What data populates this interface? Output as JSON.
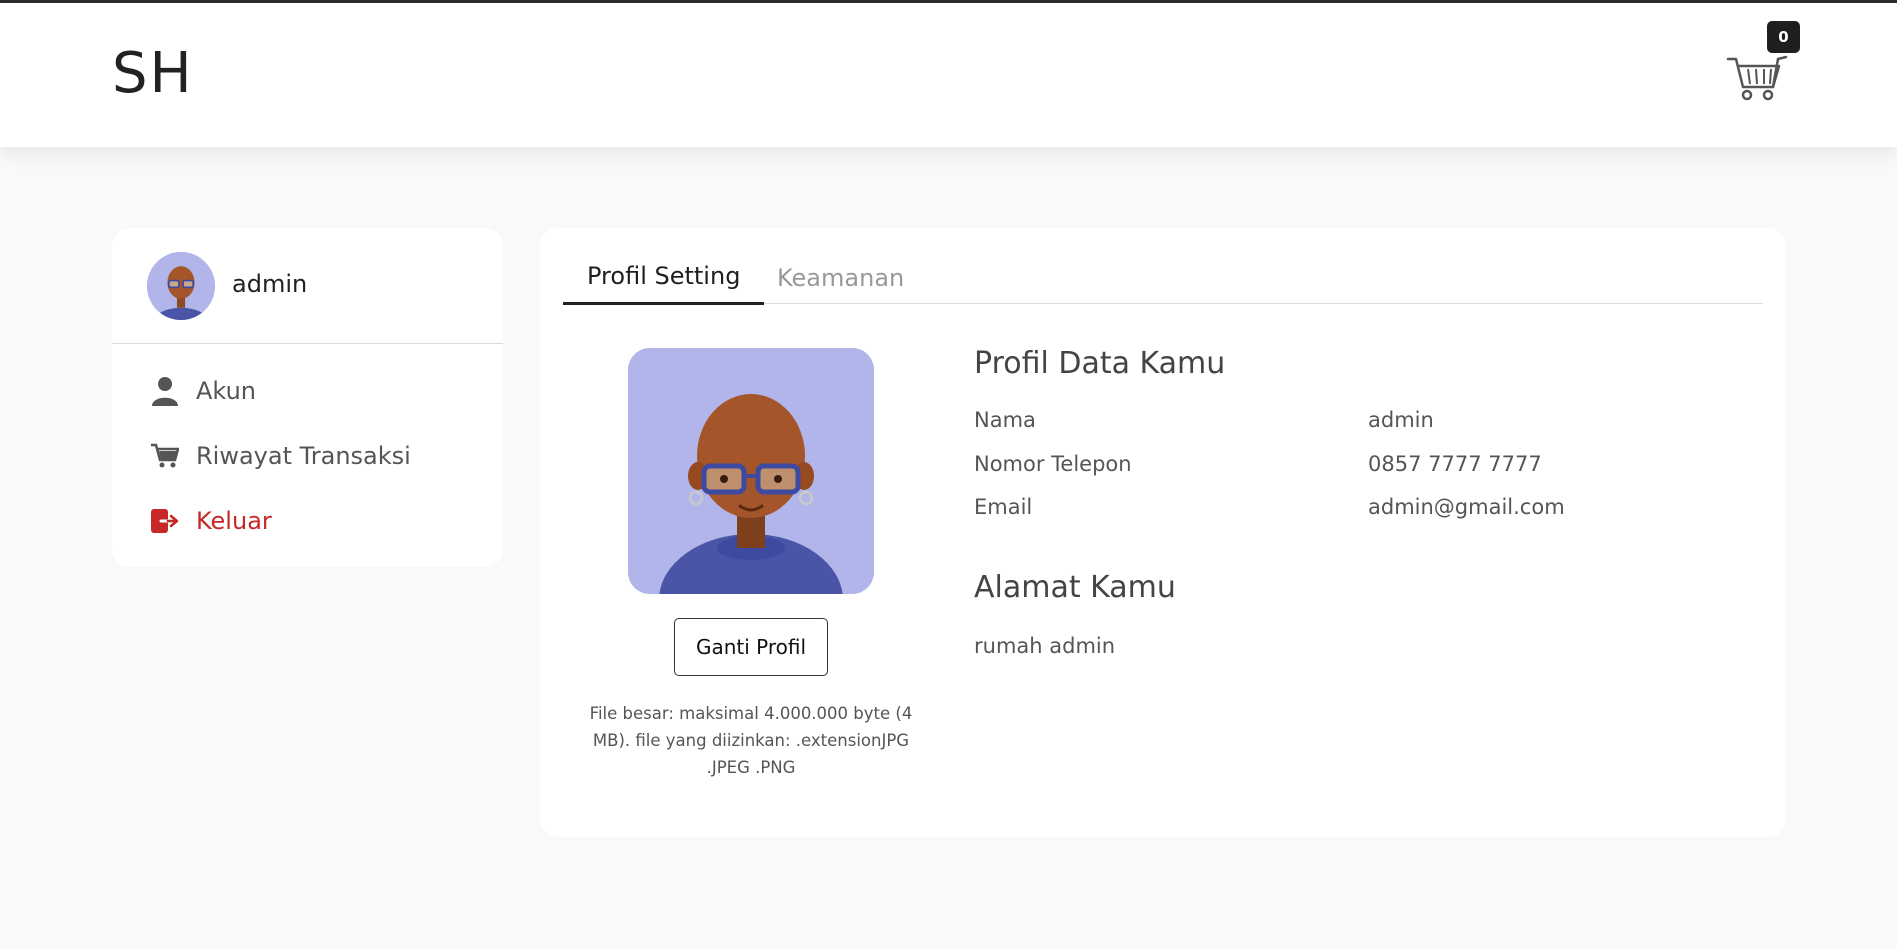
{
  "header": {
    "brand": "SH",
    "cart_count": "0"
  },
  "sidebar": {
    "username": "admin",
    "items": [
      {
        "label": "Akun",
        "icon": "user-icon"
      },
      {
        "label": "Riwayat Transaksi",
        "icon": "cart-icon"
      },
      {
        "label": "Keluar",
        "icon": "logout-icon"
      }
    ]
  },
  "tabs": [
    {
      "label": "Profil Setting",
      "active": true
    },
    {
      "label": "Keamanan",
      "active": false
    }
  ],
  "profile": {
    "change_button": "Ganti Profil",
    "file_note": "File besar: maksimal 4.000.000 byte (4 MB). file yang diizinkan: .extensionJPG .JPEG .PNG",
    "data_title": "Profil Data Kamu",
    "fields": [
      {
        "label": "Nama",
        "value": "admin"
      },
      {
        "label": "Nomor Telepon",
        "value": "0857 7777 7777"
      },
      {
        "label": "Email",
        "value": "admin@gmail.com"
      }
    ],
    "address_title": "Alamat Kamu",
    "address": "rumah admin"
  },
  "colors": {
    "avatar_bg": "#b2b5ea",
    "danger": "#c62828",
    "badge": "#1f1f1f"
  }
}
